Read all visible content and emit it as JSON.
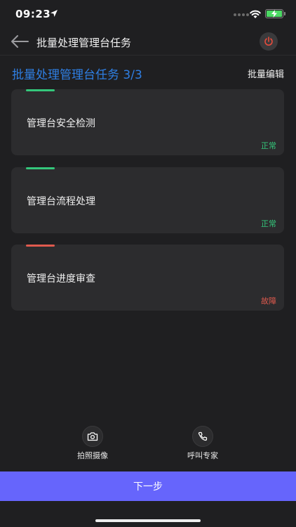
{
  "status_bar": {
    "time": "09:23"
  },
  "nav": {
    "title": "批量处理管理台任务"
  },
  "header": {
    "title": "批量处理管理台任务 3/3",
    "batch_edit_label": "批量编辑"
  },
  "tasks": [
    {
      "name": "管理台安全检测",
      "status": "正常",
      "status_color": "#34c77b"
    },
    {
      "name": "管理台流程处理",
      "status": "正常",
      "status_color": "#34c77b"
    },
    {
      "name": "管理台进度审查",
      "status": "故障",
      "status_color": "#e05a4e"
    }
  ],
  "tools": {
    "photo_label": "拍照摄像",
    "call_label": "呼叫专家"
  },
  "footer": {
    "next_label": "下一步"
  },
  "colors": {
    "accent": "#6665fc",
    "title_blue": "#2f7fe4",
    "power_red": "#e74c3c"
  }
}
